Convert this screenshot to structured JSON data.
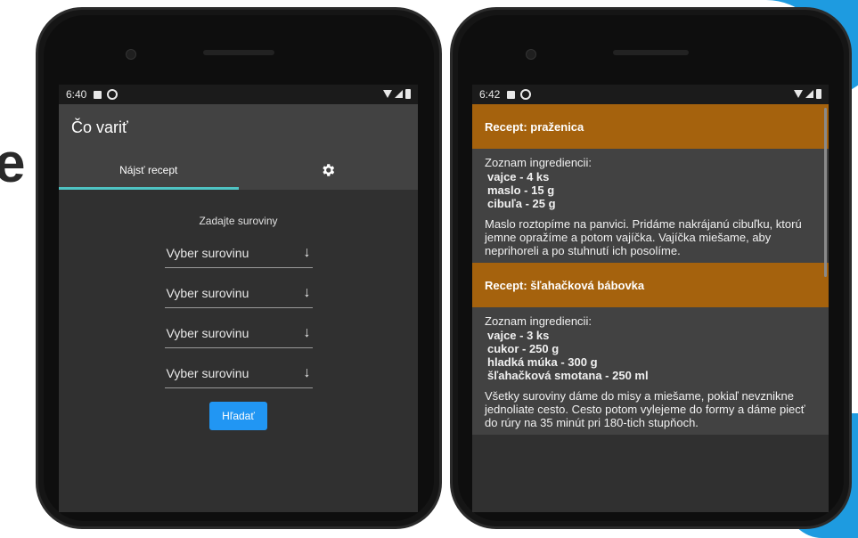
{
  "left_phone": {
    "status_time": "6:40",
    "app_title": "Čo variť",
    "tab_find_label": "Nájsť recept",
    "form_title": "Zadajte suroviny",
    "selects": [
      {
        "value": "Vyber surovinu"
      },
      {
        "value": "Vyber surovinu"
      },
      {
        "value": "Vyber surovinu"
      },
      {
        "value": "Vyber surovinu"
      }
    ],
    "search_button": "Hľadať"
  },
  "right_phone": {
    "status_time": "6:42",
    "recipes": [
      {
        "title": "Recept: praženica",
        "ingredients_label": "Zoznam ingrediencii:",
        "ingredients": [
          "vajce - 4 ks",
          "maslo - 15 g",
          "cibuľa - 25 g"
        ],
        "description": "Maslo roztopíme na panvici. Pridáme nakrájanú cibuľku, ktorú jemne opražíme a potom vajíčka. Vajíčka miešame, aby neprihoreli a po stuhnutí ich posolíme."
      },
      {
        "title": "Recept: šľahačková bábovka",
        "ingredients_label": "Zoznam ingrediencii:",
        "ingredients": [
          "vajce - 3 ks",
          "cukor - 250 g",
          "hladká múka - 300 g",
          "šľahačková smotana - 250 ml"
        ],
        "description": "Všetky suroviny dáme do misy a miešame, pokiaľ nevznikne jednoliate cesto. Cesto potom vylejeme do formy a dáme piecť do rúry na 35 minút pri 180-tich stupňoch."
      }
    ]
  },
  "colors": {
    "accent": "#2196f3",
    "recipe_header": "#a5620d",
    "tab_indicator": "#4fc3c3",
    "decoration": "#1e9be0"
  },
  "icons": {
    "settings": "gear-icon",
    "dropdown": "arrow-down-icon"
  }
}
